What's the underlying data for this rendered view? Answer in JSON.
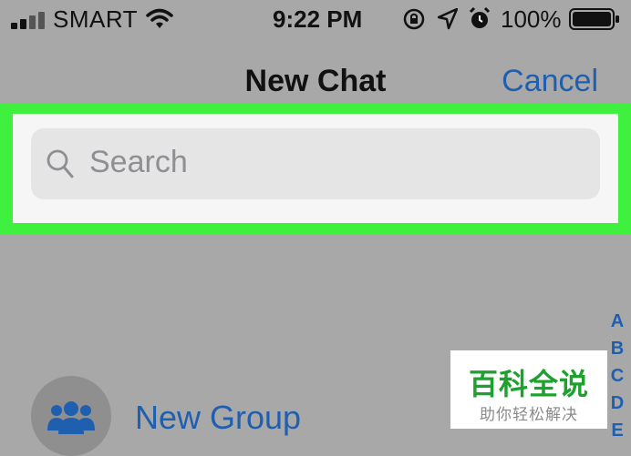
{
  "status_bar": {
    "carrier": "SMART",
    "time": "9:22 PM",
    "battery_percent": "100%",
    "icons": [
      "signal-icon",
      "wifi-icon",
      "orientation-lock-icon",
      "location-icon",
      "alarm-icon",
      "battery-icon"
    ]
  },
  "navbar": {
    "title": "New Chat",
    "cancel_label": "Cancel"
  },
  "search": {
    "placeholder": "Search",
    "value": ""
  },
  "highlight_color": "#3ff03f",
  "index_letters": [
    "A",
    "B",
    "C",
    "D",
    "E"
  ],
  "new_group": {
    "label": "New Group",
    "icon": "group-icon"
  },
  "watermark": {
    "main": "百科全说",
    "sub": "助你轻松解决"
  },
  "colors": {
    "accent": "#1f5fb0",
    "background": "#a8a8a8"
  }
}
